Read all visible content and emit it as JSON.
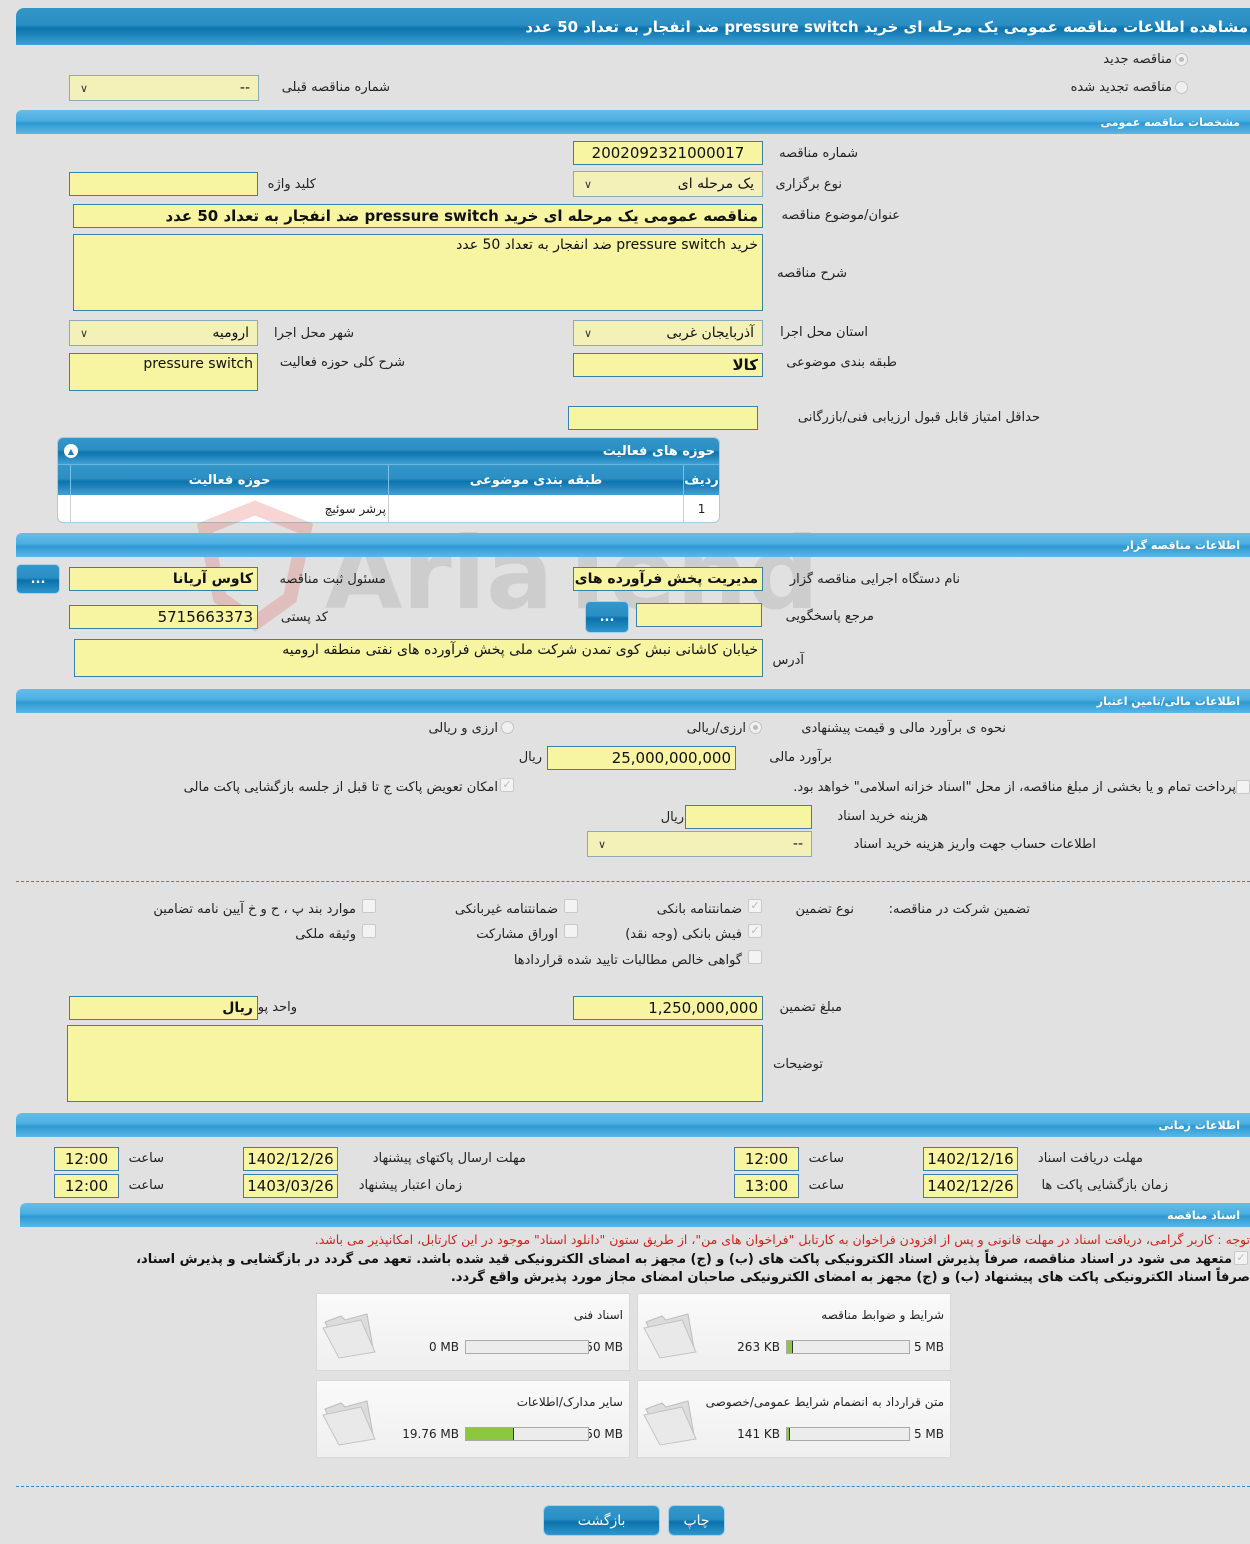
{
  "page_title": "مشاهده اطلاعات مناقصه عمومی یک مرحله ای خرید pressure switch ضد انفجار به تعداد 50 عدد",
  "tender_type": {
    "new_label": "مناقصه جدید",
    "renewed_label": "مناقصه تجدید شده",
    "selected": "new",
    "previous_number_label": "شماره مناقصه قبلی",
    "previous_number_value": "--"
  },
  "general": {
    "section_title": "مشخصات مناقصه عمومی",
    "number_label": "شماره مناقصه",
    "number_value": "2002092321000017",
    "holding_type_label": "نوع برگزاری",
    "holding_type_value": "یک مرحله ای",
    "keyword_label": "کلید واژه",
    "keyword_value": "",
    "subject_label": "عنوان/موضوع مناقصه",
    "subject_value": "مناقصه عمومی یک مرحله ای خرید pressure switch ضد انفجار به تعداد 50 عدد",
    "description_label": "شرح مناقصه",
    "description_value": "خرید pressure switch ضد انفجار به تعداد 50 عدد",
    "province_label": "استان محل اجرا",
    "province_value": "آذربایجان غربی",
    "city_label": "شهر محل اجرا",
    "city_value": "ارومیه",
    "category_label": "طبقه بندی موضوعی",
    "category_value": "کالا",
    "activity_desc_label": "شرح کلی حوزه فعالیت",
    "activity_desc_value": "pressure switch",
    "min_score_label": "حداقل امتیاز قابل قبول ارزیابی فنی/بازرگانی",
    "min_score_value": ""
  },
  "activity_table": {
    "title": "حوزه های فعالیت",
    "columns": [
      "ردیف",
      "طبقه بندی موضوعی",
      "حوزه فعالیت"
    ],
    "rows": [
      {
        "index": "1",
        "category": "",
        "activity": "پرشر سوئیچ"
      }
    ]
  },
  "organizer": {
    "section_title": "اطلاعات مناقصه گزار",
    "org_name_label": "نام دستگاه اجرایی مناقصه گزار",
    "org_name_value": "مدیریت پخش فرآورده های نفتی",
    "registrar_label": "مسئول ثبت مناقصه",
    "registrar_value": "کاوس آریانا",
    "dots_label": "...",
    "reference_label": "مرجع پاسخگویی",
    "reference_value": "",
    "postal_label": "کد پستی",
    "postal_value": "5715663373",
    "address_label": "آدرس",
    "address_value": "خیابان کاشانی نبش کوی تمدن شرکت ملی پخش فرآورده های نفتی منطقه ارومیه"
  },
  "finance": {
    "section_title": "اطلاعات مالی/تامین اعتبار",
    "estimate_method_label": "نحوه ی برآورد مالی و قیمت پیشنهادی",
    "option_rial": "ارزی/ریالی",
    "option_both": "ارزی و ریالی",
    "estimate_label": "برآورد مالی",
    "estimate_value": "25,000,000,000",
    "rial": "ریال",
    "treasury_text": "پرداخت تمام و یا بخشی از مبلغ مناقصه، از محل \"اسناد خزانه اسلامی\" خواهد بود.",
    "treasury_checked": false,
    "replace_packet_text": "امکان تعویض پاکت ج تا قبل از جلسه بازگشایی پاکت مالی",
    "replace_packet_checked": true,
    "doc_cost_label": "هزینه خرید اسناد",
    "doc_cost_value": "",
    "account_label": "اطلاعات حساب جهت واریز هزینه خرید اسناد",
    "account_value": "--"
  },
  "guarantee": {
    "label": "تضمین شرکت در مناقصه:",
    "type_label": "نوع تضمین",
    "options": [
      {
        "label": "ضمانتنامه بانکی",
        "checked": true
      },
      {
        "label": "ضمانتنامه غیربانکی",
        "checked": false
      },
      {
        "label": "موارد بند پ ، ح و خ آیین نامه تضامین",
        "checked": false
      },
      {
        "label": "فیش بانکی (وجه نقد)",
        "checked": true
      },
      {
        "label": "اوراق مشارکت",
        "checked": false
      },
      {
        "label": "وثیقه ملکی",
        "checked": false
      },
      {
        "label": "گواهی خالص مطالبات تایید شده قراردادها",
        "checked": false
      }
    ],
    "amount_label": "مبلغ تضمین",
    "amount_value": "1,250,000,000",
    "currency_label": "واحد پول",
    "currency_value": "ریال",
    "notes_label": "توضیحات",
    "notes_value": ""
  },
  "timing": {
    "section_title": "اطلاعات زمانی",
    "hour_label": "ساعت",
    "doc_deadline_label": "مهلت دریافت اسناد",
    "doc_deadline_date": "1402/12/16",
    "doc_deadline_time": "12:00",
    "submit_deadline_label": "مهلت ارسال پاکتهای پیشنهاد",
    "submit_deadline_date": "1402/12/26",
    "submit_deadline_time": "12:00",
    "opening_label": "زمان بازگشایی پاکت ها",
    "opening_date": "1402/12/26",
    "opening_time": "13:00",
    "validity_label": "زمان اعتبار پیشنهاد",
    "validity_date": "1403/03/26",
    "validity_time": "12:00"
  },
  "documents": {
    "section_title": "اسناد مناقصه",
    "notice": "توجه : کاربر گرامی، دریافت اسناد در مهلت قانونی و پس از افزودن فراخوان به کارتابل \"فراخوان های من\"، از طریق ستون \"دانلود اسناد\" موجود در این کارتابل، امکانپذیر می باشد.",
    "commitment_line1": "متعهد می شود در اسناد مناقصه، صرفاً پذیرش اسناد الکترونیکی پاکت های (ب) و (ج) مجهز به امضای الکترونیکی قید شده باشد. تعهد می گردد در بازگشایی و پذیرش اسناد،",
    "commitment_line2": "صرفاً اسناد الکترونیکی پاکت های پیشنهاد (ب) و (ج) مجهز به امضای الکترونیکی صاحبان امضای مجاز مورد پذیرش واقع گردد.",
    "items": [
      {
        "name": "شرایط و ضوابط مناقصه",
        "current": "263 KB",
        "max": "5 MB",
        "fill_percent": 5.1
      },
      {
        "name": "اسناد فنی",
        "current": "0 MB",
        "max": "50 MB",
        "fill_percent": 0
      },
      {
        "name": "متن قرارداد به انضمام شرایط عمومی/خصوصی",
        "current": "141 KB",
        "max": "5 MB",
        "fill_percent": 2.8
      },
      {
        "name": "سایر مدارک/اطلاعات",
        "current": "19.76 MB",
        "max": "50 MB",
        "fill_percent": 39.5
      }
    ]
  },
  "actions": {
    "print": "چاپ",
    "back": "بازگشت"
  },
  "watermark": "AriaTender.neT"
}
